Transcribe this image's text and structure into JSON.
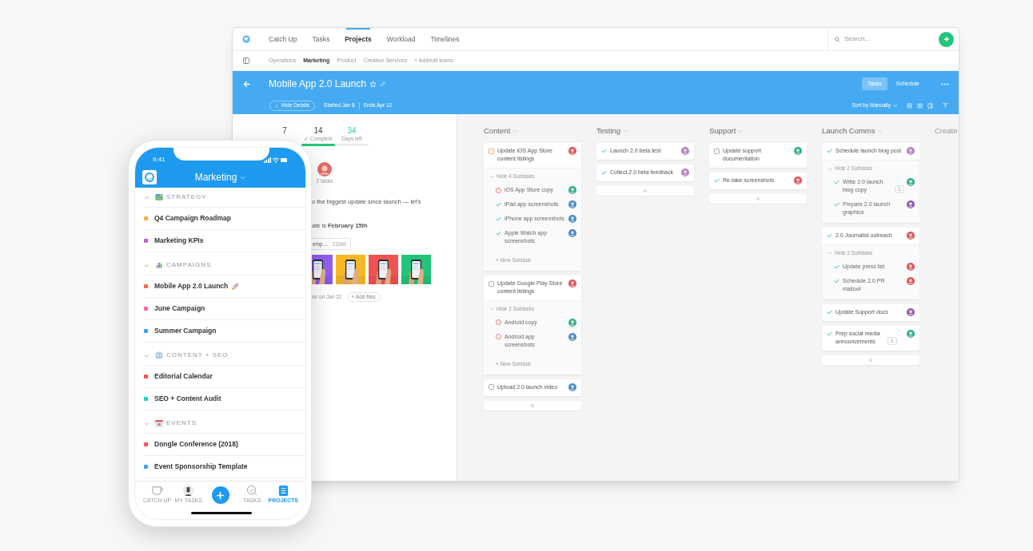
{
  "app_nav": {
    "tabs": [
      {
        "label": "Catch Up",
        "selected": false
      },
      {
        "label": "Tasks",
        "selected": false
      },
      {
        "label": "Projects",
        "selected": true
      },
      {
        "label": "Workload",
        "selected": false
      },
      {
        "label": "Timelines",
        "selected": false
      }
    ],
    "search": {
      "placeholder": "Search..."
    }
  },
  "teams": {
    "items": [
      {
        "label": "Operations",
        "selected": false
      },
      {
        "label": "Marketing",
        "selected": true
      },
      {
        "label": "Product",
        "selected": false
      },
      {
        "label": "Creative Services",
        "selected": false
      }
    ],
    "add_link": "+ Add/edit teams"
  },
  "project_header": {
    "title": "Mobile App 2.0 Launch",
    "views": [
      {
        "label": "Tasks",
        "selected": true
      },
      {
        "label": "Schedule",
        "selected": false
      }
    ],
    "hide_details": "Hide Details",
    "started": "Started Jan 8",
    "ends": "Ends Apr 12",
    "sort": "Sort by Manually"
  },
  "details": {
    "stats": [
      {
        "value": "7",
        "kind": "plain"
      },
      {
        "value": "14",
        "label": "✓ Complete",
        "kind": "plain"
      },
      {
        "value": "34",
        "label": "Days left",
        "kind": "highlight"
      }
    ],
    "progress": {
      "level": 0.5
    },
    "assignee_tasks": "2 tasks",
    "description": "o the biggest update since launch — let's",
    "due_line": "ate is **February 15th**",
    "file": {
      "name": "emp...",
      "size": "111kb"
    },
    "uploaded": "an on Jan 31",
    "add_files": "+ Add files"
  },
  "board": {
    "columns": [
      {
        "title": "Content",
        "cards": [
          {
            "title": "Update iOS App Store content listings",
            "kind": "doing",
            "color": "#e0525a",
            "subtasks_toggle": "Hide 4 Subtasks",
            "subtasks": [
              {
                "title": "iOS App Store copy",
                "kind": "todo",
                "color": "#26b48a"
              },
              {
                "title": "iPad app screenshots",
                "kind": "done",
                "color": "#3b8fd6"
              },
              {
                "title": "iPhone app screenshots",
                "kind": "done",
                "color": "#3b8fd6"
              },
              {
                "title": "Apple Watch app screenshots",
                "kind": "done",
                "color": "#3b8fd6"
              }
            ],
            "new_subtask": "+ New Subtask"
          },
          {
            "title": "Update Google Play Store content listings",
            "kind": "todo",
            "color": "#e0525a",
            "subtasks_toggle": "Hide 2 Subtasks",
            "subtasks": [
              {
                "title": "Android copy",
                "kind": "todo",
                "color": "#26b48a"
              },
              {
                "title": "Android app screenshots",
                "kind": "todo",
                "color": "#3b8fd6"
              }
            ],
            "new_subtask": "+ New Subtask"
          },
          {
            "title": "Upload 2.0 launch video",
            "kind": "todo",
            "color": "#3b8fd6"
          }
        ]
      },
      {
        "title": "Testing",
        "cards": [
          {
            "title": "Launch 2.0 beta test",
            "kind": "done",
            "color": "#b37fd0"
          },
          {
            "title": "Collect 2.0 beta feedback",
            "kind": "done",
            "color": "#b37fd0"
          }
        ]
      },
      {
        "title": "Support",
        "cards": [
          {
            "title": "Update support documentation",
            "kind": "todo",
            "color": "#26b48a"
          },
          {
            "title": "Re-take screenshots",
            "kind": "done",
            "color": "#e0525a"
          }
        ]
      },
      {
        "title": "Launch Comms",
        "cards": [
          {
            "title": "Schedule launch blog post",
            "kind": "done",
            "color": "#b37fd0",
            "subtasks_toggle": "Hide 2 Subtasks",
            "subtasks": [
              {
                "title": "Write 2.0 launch blog copy",
                "kind": "done",
                "color": "#26b48a",
                "comments": "1"
              },
              {
                "title": "Prepare 2.0 launch graphics",
                "kind": "done",
                "color": "#8e5bb5"
              }
            ]
          },
          {
            "title": "2.0 Journalist outreach",
            "kind": "done",
            "color": "#e0525a",
            "subtasks_toggle": "Hide 2 Subtasks",
            "subtasks": [
              {
                "title": "Update press list",
                "kind": "done",
                "color": "#e0525a"
              },
              {
                "title": "Schedule 2.0 PR mailout",
                "kind": "done",
                "color": "#e0525a"
              }
            ]
          },
          {
            "title": "Update Support docs",
            "kind": "done",
            "color": "#8e5bb5"
          },
          {
            "title": "Prep social media announcements",
            "kind": "done",
            "color": "#26b48a",
            "comments": "1"
          }
        ]
      }
    ],
    "create": "Create"
  },
  "phone": {
    "time": "9:41",
    "team": "Marketing",
    "sections": [
      {
        "title": "STRATEGY",
        "expanded": true,
        "items": [
          {
            "title": "Q4 Campaign Roadmap",
            "color": "#f7a94b"
          },
          {
            "title": "Marketing KPIs",
            "color": "#b865c9"
          }
        ]
      },
      {
        "title": "CAMPAIGNS",
        "expanded": true,
        "items": [
          {
            "title": "Mobile App 2.0 Launch",
            "color": "#f46d4f"
          },
          {
            "title": "June Campaign",
            "color": "#f265a8"
          },
          {
            "title": "Summer Campaign",
            "color": "#3fa2f0"
          }
        ]
      },
      {
        "title": "CONTENT + SEO",
        "expanded": true,
        "items": [
          {
            "title": "Editorial Calendar",
            "color": "#f2545b"
          },
          {
            "title": "SEO + Content Audit",
            "color": "#1fd1c1"
          }
        ]
      },
      {
        "title": "EVENTS",
        "expanded": true,
        "items": [
          {
            "title": "Dongle Conference (2018)",
            "color": "#f2545b"
          },
          {
            "title": "Event Sponsorship Template",
            "color": "#3fa2f0"
          }
        ]
      }
    ],
    "tabs": [
      {
        "label": "CATCH UP",
        "selected": false
      },
      {
        "label": "MY TASKS",
        "selected": false
      },
      {
        "label": "TASKS",
        "selected": false
      },
      {
        "label": "PROJECTS",
        "selected": true
      }
    ]
  }
}
